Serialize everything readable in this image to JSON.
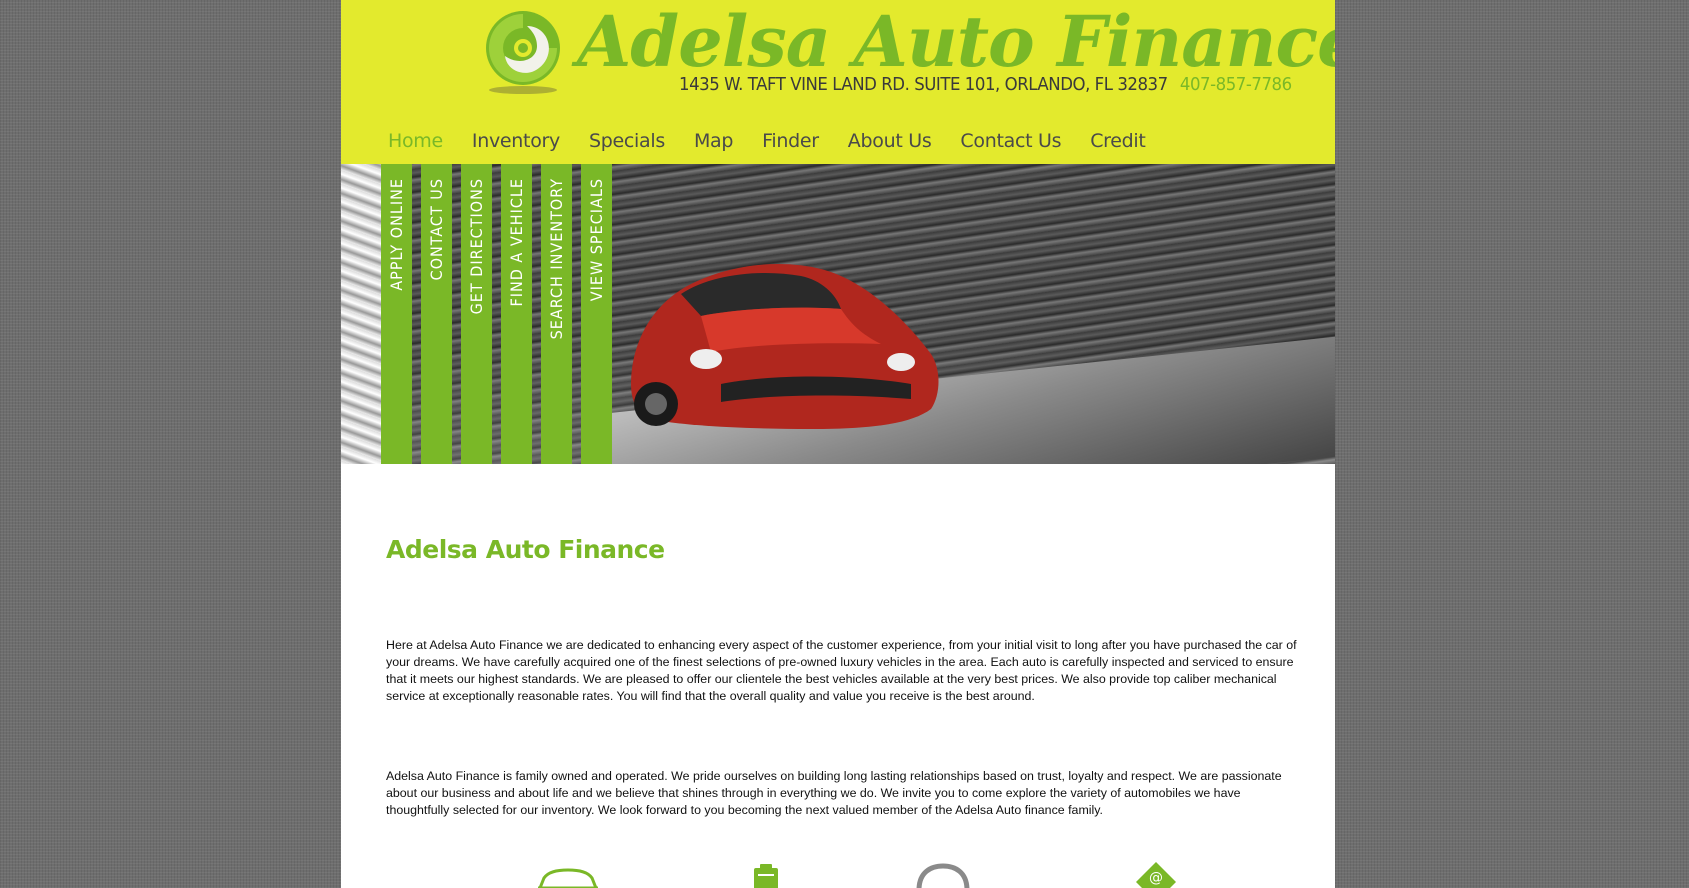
{
  "brand": {
    "name": "Adelsa Auto Finance",
    "address": "1435 W. TAFT VINE LAND RD. SUITE 101, ORLANDO, FL 32837",
    "phone": "407-857-7786",
    "accent_color": "#7ab827",
    "header_color": "#e3ea2d"
  },
  "nav": {
    "items": [
      {
        "label": "Home"
      },
      {
        "label": "Inventory"
      },
      {
        "label": "Specials"
      },
      {
        "label": "Map"
      },
      {
        "label": "Finder"
      },
      {
        "label": "About Us"
      },
      {
        "label": "Contact Us"
      },
      {
        "label": "Credit"
      }
    ],
    "active": "Home"
  },
  "hero": {
    "tabs": [
      {
        "label": "APPLY ONLINE"
      },
      {
        "label": "CONTACT US"
      },
      {
        "label": "GET DIRECTIONS"
      },
      {
        "label": "FIND A VEHICLE"
      },
      {
        "label": "SEARCH INVENTORY"
      },
      {
        "label": "VIEW SPECIALS"
      }
    ]
  },
  "main": {
    "title": "Adelsa Auto Finance",
    "paragraphs": [
      "Here at Adelsa Auto Finance we are dedicated to enhancing every aspect of the customer experience, from your initial visit to long after you have purchased the car of your dreams. We have carefully acquired one of the finest selections of pre-owned luxury vehicles in the area. Each auto is carefully inspected and serviced to ensure that it meets our highest standards. We are pleased to offer our clientele the best vehicles available at the very best prices. We also provide top caliber mechanical service at exceptionally reasonable rates. You will find that the overall quality and value you receive is the best around.",
      "Adelsa Auto Finance is family owned and operated. We pride ourselves on building long lasting relationships based on trust, loyalty and respect. We are passionate about our business and about life and we believe that shines through in everything we do. We invite you to come explore the variety of automobiles we have thoughtfully selected for our inventory. We look forward to you becoming the next valued member of the Adelsa Auto finance family."
    ]
  },
  "bottom_icons": [
    "car-icon",
    "clipboard-icon",
    "phone-icon",
    "email-icon"
  ]
}
